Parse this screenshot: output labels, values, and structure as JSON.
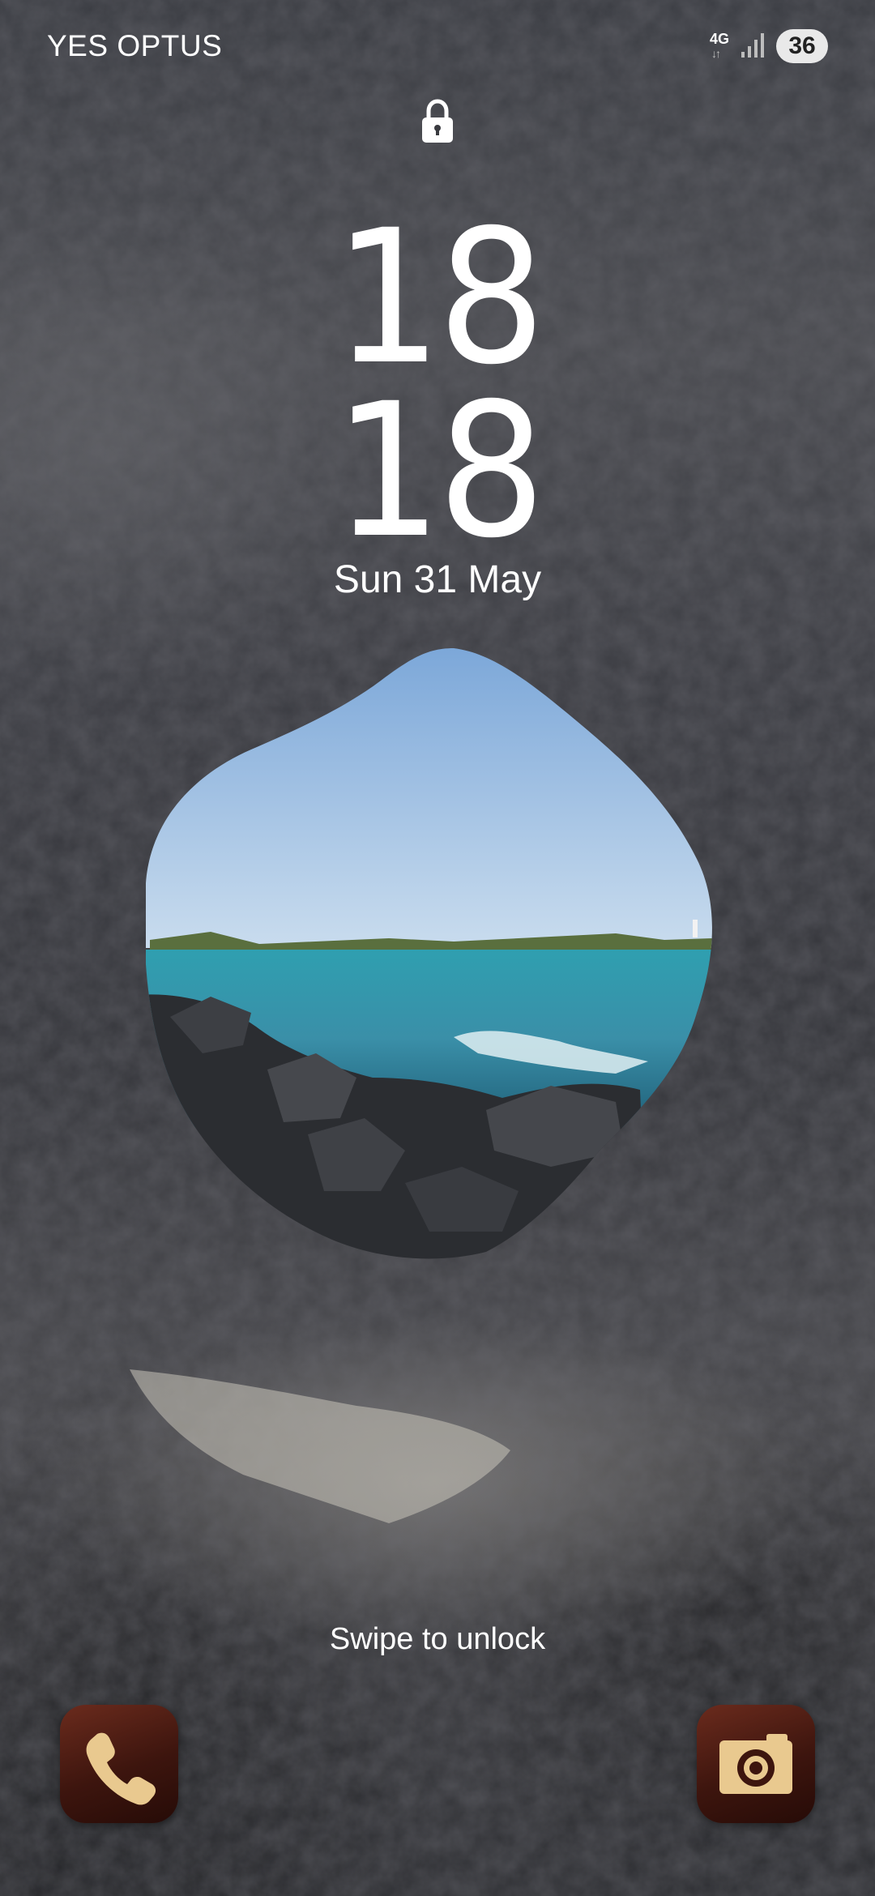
{
  "status_bar": {
    "carrier": "YES OPTUS",
    "network_type": "4G",
    "network_arrows": "↓↑",
    "signal_icon": "signal-bars-icon",
    "battery_level": "36"
  },
  "lock_screen": {
    "lock_icon": "padlock-icon",
    "clock_hours": "18",
    "clock_minutes": "18",
    "date": "Sun 31 May",
    "swipe_hint": "Swipe to unlock"
  },
  "shortcuts": [
    {
      "name": "phone",
      "icon": "phone-handset-icon"
    },
    {
      "name": "camera",
      "icon": "camera-icon"
    }
  ],
  "colors": {
    "text": "#ffffff",
    "shortcut_bg": "#4a1b11",
    "shortcut_glyph": "#e9c98f",
    "battery_badge": "#e9e9e9"
  }
}
